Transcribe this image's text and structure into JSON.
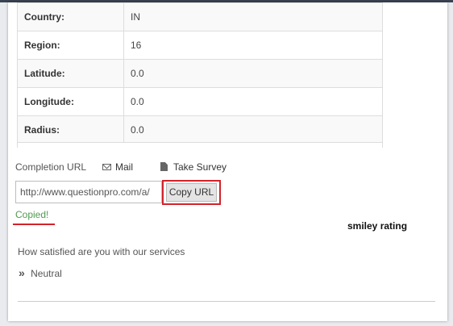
{
  "info_table": [
    {
      "label": "Country:",
      "value": "IN"
    },
    {
      "label": "Region:",
      "value": "16"
    },
    {
      "label": "Latitude:",
      "value": "0.0"
    },
    {
      "label": "Longitude:",
      "value": "0.0"
    },
    {
      "label": "Radius:",
      "value": "0.0"
    }
  ],
  "completion": {
    "label": "Completion URL",
    "mail_label": "Mail",
    "take_survey_label": "Take Survey",
    "url_value": "http://www.questionpro.com/a/",
    "copy_button_label": "Copy URL",
    "copied_status": "Copied!"
  },
  "annotation": {
    "text": "smiley rating"
  },
  "question": {
    "text": "How satisfied are you with our services",
    "answer": "Neutral"
  },
  "icons": {
    "mail": "envelope-icon",
    "survey": "file-icon",
    "answer": "double-chevron-right-icon"
  },
  "colors": {
    "highlight": "#d3222a",
    "copied": "#4f9a4f"
  }
}
